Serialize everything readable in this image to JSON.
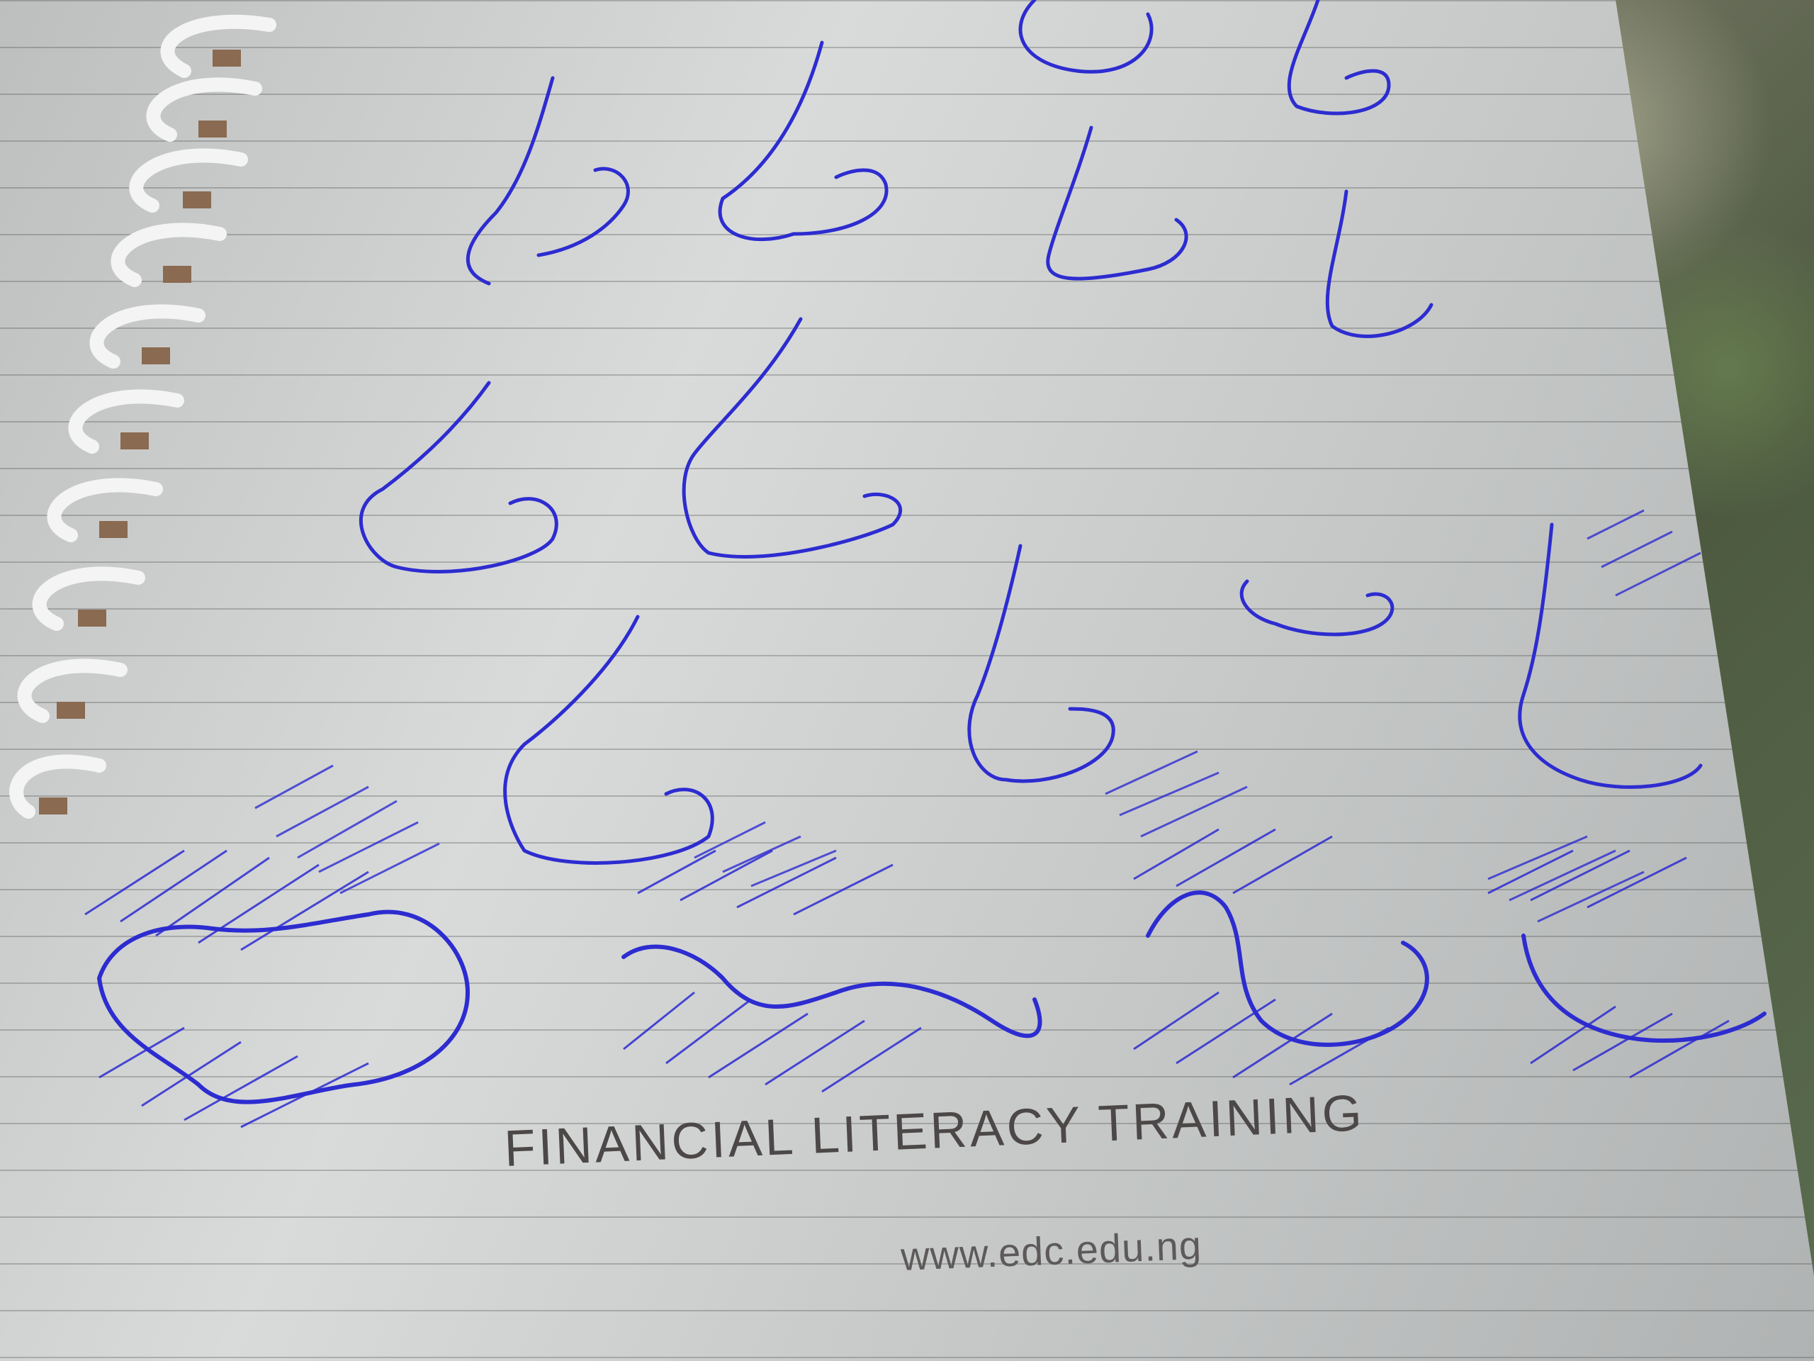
{
  "photo": {
    "subject": "notebook-nose-sketches"
  },
  "footer": {
    "title": "FINANCIAL LITERACY TRAINING",
    "url": "www.edc.edu.ng"
  },
  "colors": {
    "ink": "#2d2cd0",
    "paper": "#d4d6d6",
    "print": "#4c4847"
  }
}
